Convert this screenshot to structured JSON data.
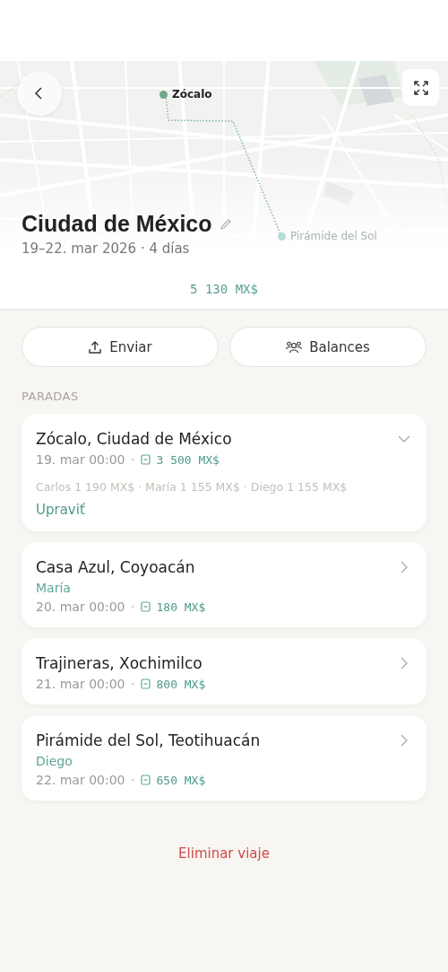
{
  "map": {
    "kind": "picture",
    "markers": [
      {
        "label": "Zócalo",
        "selected": true
      },
      {
        "label": "Pirámide del Sol",
        "selected": false
      }
    ]
  },
  "trip": {
    "title": "Ciudad de México",
    "dates": "19–22. mar 2026 · 4 días",
    "total": "5 130 MX$"
  },
  "actions": [
    {
      "kind": "share",
      "label": "Enviar"
    },
    {
      "kind": "balances",
      "label": "Balances"
    }
  ],
  "stops_heading": "PARADAS",
  "stops": [
    {
      "name": "Zócalo, Ciudad de México",
      "expanded": true,
      "date": "19. mar 00:00",
      "amount": "3 500 MX$",
      "splits": "Carlos 1 190 MX$ · María 1 155 MX$ · Diego 1 155 MX$",
      "edit_link": "Upraviť"
    },
    {
      "name": "Casa Azul, Coyoacán",
      "expanded": false,
      "payer": "María",
      "date": "20. mar 00:00",
      "amount": "180 MX$"
    },
    {
      "name": "Trajineras, Xochimilco",
      "expanded": false,
      "date": "21. mar 00:00",
      "amount": "800 MX$"
    },
    {
      "name": "Pirámide del Sol, Teotihuacán",
      "expanded": false,
      "payer": "Diego",
      "date": "22. mar 00:00",
      "amount": "650 MX$"
    }
  ],
  "delete_label": "Eliminar viaje"
}
